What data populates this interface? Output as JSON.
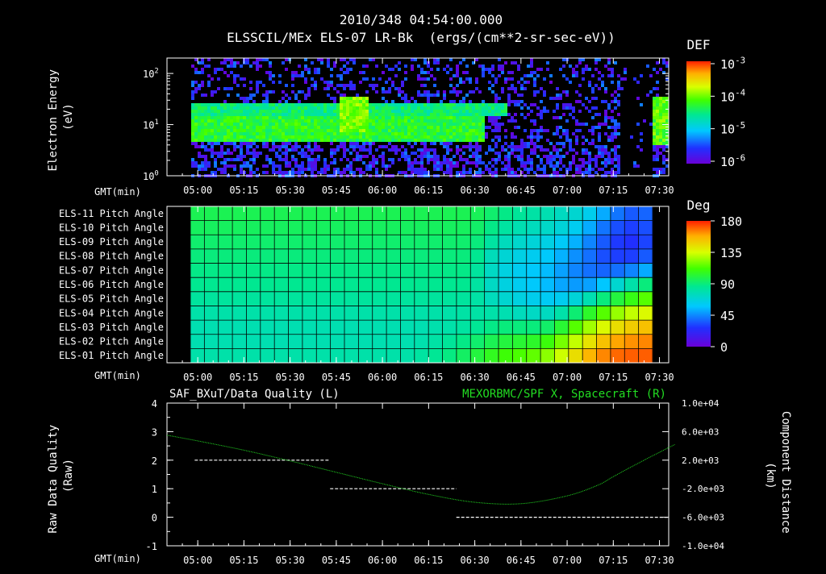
{
  "header": {
    "timestamp": "2010/348 04:54:00.000",
    "subtitle": "ELSSCIL/MEx ELS-07 LR-Bk  (ergs/(cm**2-sr-sec-eV))"
  },
  "colors": {
    "background": "#000000",
    "foreground": "#ffffff",
    "green_series": "#22dd22",
    "colormap": [
      "#6a00d8",
      "#2030ff",
      "#00c8ff",
      "#00e890",
      "#40ff00",
      "#d8ff00",
      "#ffb000",
      "#ff2000"
    ]
  },
  "time_ticks": [
    "05:00",
    "05:15",
    "05:30",
    "05:45",
    "06:00",
    "06:15",
    "06:30",
    "06:45",
    "07:00",
    "07:15",
    "07:30"
  ],
  "chart_data": [
    {
      "type": "heatmap",
      "name": "electron-spectrogram",
      "ylabel": "Electron Energy (eV)",
      "xlabel": "GMT(min)",
      "yscale": "log",
      "ylim": [
        1,
        200
      ],
      "y_ticks": [
        "10^0",
        "10^1",
        "10^2"
      ],
      "x_start_min": 290,
      "x_end_min": 453,
      "colorbar": {
        "label": "DEF",
        "scale": "log",
        "range": [
          1e-06,
          0.001
        ],
        "ticks": [
          "10^-3",
          "10^-4",
          "10^-5",
          "10^-6"
        ]
      },
      "features": [
        {
          "x_range": [
            "04:57",
            "06:33"
          ],
          "energy_eV": [
            5,
            15
          ],
          "level": "1e-5 to 1e-4"
        },
        {
          "x_range": [
            "05:46",
            "05:55"
          ],
          "energy_eV": [
            8,
            40
          ],
          "level": "~1e-4"
        },
        {
          "x_range": [
            "07:27",
            "07:35"
          ],
          "energy_eV": [
            4,
            40
          ],
          "level": "~1e-4"
        }
      ]
    },
    {
      "type": "heatmap",
      "name": "pitch-angle-grid",
      "xlabel": "GMT(min)",
      "row_labels": [
        "ELS-11 Pitch Angle",
        "ELS-10 Pitch Angle",
        "ELS-09 Pitch Angle",
        "ELS-08 Pitch Angle",
        "ELS-07 Pitch Angle",
        "ELS-06 Pitch Angle",
        "ELS-05 Pitch Angle",
        "ELS-04 Pitch Angle",
        "ELS-03 Pitch Angle",
        "ELS-02 Pitch Angle",
        "ELS-01 Pitch Angle"
      ],
      "columns": 33,
      "colorbar": {
        "label": "Deg",
        "range": [
          0,
          180
        ],
        "ticks": [
          "180",
          "135",
          "90",
          "45",
          "0"
        ]
      },
      "values_deg": [
        [
          80,
          80,
          80,
          80,
          80,
          80,
          80,
          80,
          80,
          80,
          80,
          80,
          80,
          80,
          80,
          80,
          80,
          80,
          80,
          80,
          79,
          75,
          70,
          66,
          63,
          60,
          56,
          52,
          45,
          35,
          25,
          20,
          22
        ],
        [
          78,
          78,
          78,
          78,
          78,
          78,
          78,
          78,
          78,
          78,
          78,
          78,
          78,
          78,
          78,
          78,
          78,
          78,
          78,
          78,
          76,
          70,
          64,
          60,
          57,
          54,
          50,
          44,
          35,
          25,
          18,
          15,
          18
        ],
        [
          75,
          75,
          75,
          75,
          75,
          75,
          75,
          75,
          75,
          75,
          75,
          75,
          75,
          75,
          75,
          75,
          75,
          75,
          75,
          75,
          72,
          64,
          57,
          53,
          50,
          47,
          42,
          36,
          28,
          20,
          14,
          12,
          16
        ],
        [
          72,
          72,
          72,
          72,
          72,
          72,
          72,
          72,
          72,
          72,
          72,
          72,
          72,
          72,
          72,
          72,
          72,
          72,
          72,
          72,
          68,
          58,
          51,
          47,
          44,
          41,
          36,
          30,
          24,
          18,
          15,
          15,
          20
        ],
        [
          70,
          70,
          70,
          70,
          70,
          70,
          70,
          70,
          70,
          70,
          70,
          70,
          70,
          70,
          70,
          70,
          70,
          70,
          70,
          70,
          65,
          55,
          48,
          44,
          41,
          38,
          33,
          28,
          24,
          22,
          24,
          28,
          35
        ],
        [
          68,
          68,
          68,
          68,
          68,
          68,
          68,
          68,
          68,
          68,
          68,
          68,
          68,
          68,
          68,
          68,
          68,
          68,
          68,
          68,
          64,
          55,
          48,
          44,
          41,
          38,
          34,
          32,
          33,
          40,
          52,
          62,
          72
        ],
        [
          65,
          65,
          65,
          65,
          65,
          65,
          65,
          65,
          65,
          65,
          65,
          65,
          65,
          65,
          65,
          65,
          65,
          65,
          65,
          65,
          63,
          57,
          52,
          48,
          45,
          43,
          44,
          50,
          60,
          72,
          84,
          92,
          100
        ],
        [
          62,
          62,
          62,
          62,
          62,
          62,
          62,
          62,
          62,
          62,
          62,
          62,
          62,
          62,
          62,
          62,
          62,
          62,
          62,
          63,
          63,
          62,
          60,
          57,
          55,
          56,
          62,
          74,
          88,
          100,
          112,
          120,
          126
        ],
        [
          60,
          60,
          60,
          60,
          60,
          60,
          60,
          60,
          60,
          60,
          60,
          60,
          60,
          60,
          60,
          60,
          60,
          61,
          62,
          64,
          67,
          70,
          72,
          72,
          72,
          76,
          86,
          100,
          114,
          126,
          136,
          142,
          146
        ],
        [
          60,
          60,
          60,
          60,
          60,
          60,
          60,
          60,
          60,
          60,
          60,
          60,
          60,
          60,
          60,
          60,
          61,
          63,
          66,
          70,
          75,
          80,
          84,
          86,
          88,
          94,
          106,
          120,
          134,
          146,
          154,
          158,
          160
        ],
        [
          62,
          62,
          62,
          62,
          62,
          62,
          62,
          62,
          62,
          62,
          62,
          62,
          62,
          62,
          62,
          62,
          64,
          67,
          71,
          77,
          84,
          90,
          95,
          98,
          102,
          110,
          122,
          136,
          150,
          160,
          166,
          168,
          168
        ]
      ]
    },
    {
      "type": "line",
      "name": "quality-and-distance",
      "title_left": "SAF_BXuT/Data Quality (L)",
      "title_right": "MEXORBMC/SPF X, Spacecraft (R)",
      "xlabel": "GMT(min)",
      "ylabel_left": "Raw Data Quality (Raw)",
      "ylabel_right": "Component Distance (km)",
      "ylim_left": [
        -1,
        4
      ],
      "y_ticks_left": [
        "4",
        "3",
        "2",
        "1",
        "0",
        "-1"
      ],
      "ylim_right": [
        -10000,
        10000
      ],
      "y_ticks_right": [
        "1.0e+04",
        "6.0e+03",
        "2.0e+03",
        "-2.0e+03",
        "-6.0e+03",
        "-1.0e+04"
      ],
      "x_start_min": 290,
      "x_end_min": 453,
      "series": [
        {
          "axis": "left",
          "segments": [
            {
              "x": [
                "04:59",
                "05:43"
              ],
              "y": 2
            },
            {
              "x": [
                "05:43",
                "06:24"
              ],
              "y": 1
            },
            {
              "x": [
                "06:24",
                "07:33"
              ],
              "y": 0
            }
          ]
        },
        {
          "axis": "right",
          "x": [
            "04:50",
            "05:00",
            "05:15",
            "05:30",
            "05:45",
            "06:00",
            "06:15",
            "06:30",
            "06:45",
            "07:00",
            "07:10",
            "07:15",
            "07:25",
            "07:35"
          ],
          "y": [
            5500,
            4700,
            3400,
            1900,
            300,
            -1300,
            -2800,
            -3900,
            -4100,
            -3000,
            -1500,
            -300,
            2000,
            4200
          ]
        }
      ]
    }
  ]
}
